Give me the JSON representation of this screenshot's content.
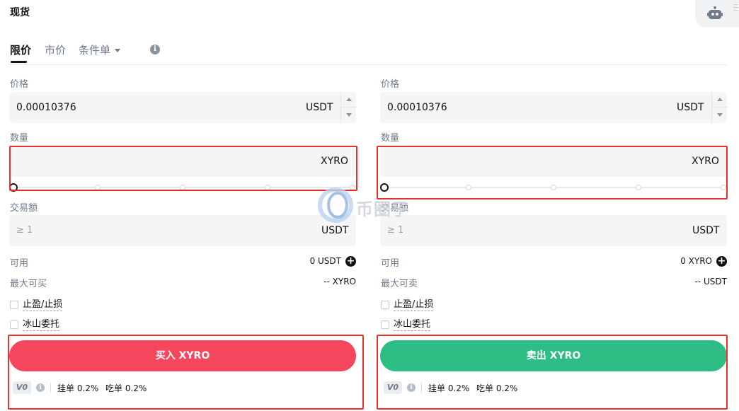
{
  "page": {
    "title": "现货"
  },
  "tabs": [
    {
      "label": "限价",
      "active": true
    },
    {
      "label": "市价",
      "active": false
    },
    {
      "label": "条件单",
      "active": false
    }
  ],
  "buy": {
    "price_label": "价格",
    "price_value": "0.00010376",
    "price_unit": "USDT",
    "amount_label": "数量",
    "amount_value": "",
    "amount_unit": "XYRO",
    "total_label": "交易额",
    "total_placeholder": "≥ 1",
    "total_unit": "USDT",
    "available_label": "可用",
    "available_value": "0 USDT",
    "max_label": "最大可买",
    "max_value": "-- XYRO",
    "tpsl_label": "止盈/止损",
    "iceberg_label": "冰山委托",
    "button_label": "买入 XYRO",
    "fee_tier": "V0",
    "maker_fee": "挂单 0.2%",
    "taker_fee": "吃单 0.2%"
  },
  "sell": {
    "price_label": "价格",
    "price_value": "0.00010376",
    "price_unit": "USDT",
    "amount_label": "数量",
    "amount_value": "",
    "amount_unit": "XYRO",
    "total_label": "交易额",
    "total_placeholder": "≥ 1",
    "total_unit": "USDT",
    "available_label": "可用",
    "available_value": "0 XYRO",
    "max_label": "最大可卖",
    "max_value": "-- USDT",
    "tpsl_label": "止盈/止损",
    "iceberg_label": "冰山委托",
    "button_label": "卖出 XYRO",
    "fee_tier": "V0",
    "maker_fee": "挂单 0.2%",
    "taker_fee": "吃单 0.2%"
  },
  "slider": {
    "position_fraction": 0
  },
  "watermark": {
    "text": "币圈子"
  },
  "icons": {
    "robot": "robot-icon",
    "info": "info-icon",
    "add": "plus-circle-icon",
    "menu": "menu-lines-icon"
  },
  "colors": {
    "buy": "#f6465d",
    "sell": "#2ebd85",
    "highlight": "#e8312f"
  }
}
